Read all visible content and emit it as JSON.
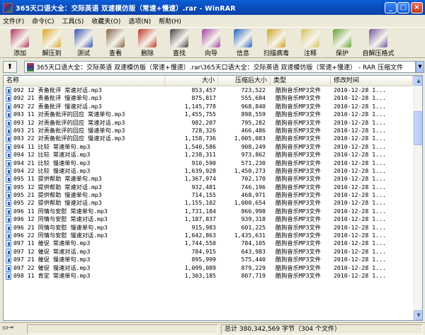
{
  "window": {
    "title": "365天口语大全：交际英语 双速模仿版（常速+慢速）.rar - WinRAR",
    "minimize": "_",
    "maximize": "□",
    "close": "×"
  },
  "menu": [
    "文件(F)",
    "命令(C)",
    "工具(S)",
    "收藏夹(O)",
    "选项(N)",
    "帮助(H)"
  ],
  "toolbar": [
    {
      "label": "添加",
      "icon": "add-books-icon",
      "color": "#b03060"
    },
    {
      "label": "解压到",
      "icon": "extract-folder-icon",
      "color": "#d9a520"
    },
    {
      "label": "测试",
      "icon": "test-check-icon",
      "color": "#3050b0"
    },
    {
      "label": "查看",
      "icon": "view-glasses-icon",
      "color": "#806040"
    },
    {
      "label": "删除",
      "icon": "delete-icon",
      "color": "#c03020"
    },
    {
      "label": "查找",
      "icon": "find-binoculars-icon",
      "color": "#404040"
    },
    {
      "label": "向导",
      "icon": "wizard-icon",
      "color": "#a040a0"
    },
    {
      "label": "信息",
      "icon": "info-icon",
      "color": "#2060c0"
    },
    {
      "label": "扫描病毒",
      "icon": "virus-scan-icon",
      "color": "#d0a020"
    },
    {
      "label": "注释",
      "icon": "comment-icon",
      "color": "#d8c060"
    },
    {
      "label": "保护",
      "icon": "protect-shield-icon",
      "color": "#60a030"
    },
    {
      "label": "自解压格式",
      "icon": "sfx-icon",
      "color": "#7050a0"
    }
  ],
  "address": {
    "path": "365天口语大全：交际英语 双速模仿版（常速+慢速）.rar\\365天口语大全：交际英语 双速模仿版（常速+慢速） - RAR 压缩文件"
  },
  "columns": {
    "name": "名称",
    "size": "大小",
    "packed": "压缩后大小",
    "type": "类型",
    "modified": "修改时间"
  },
  "files": [
    {
      "name": "092 12 责备批评 常速对话.mp3",
      "size": "853,457",
      "packed": "723,522",
      "type": "酷狗音乐MP3文件",
      "modified": "2010-12-28 1..."
    },
    {
      "name": "092 21 责备批评 慢速单句.mp3",
      "size": "875,817",
      "packed": "555,684",
      "type": "酷狗音乐MP3文件",
      "modified": "2010-12-28 1..."
    },
    {
      "name": "092 22 责备批评 慢速对话.mp3",
      "size": "1,145,778",
      "packed": "968,840",
      "type": "酷狗音乐MP3文件",
      "modified": "2010-12-28 1..."
    },
    {
      "name": "093 11 对责备批评的回应 常速单句.mp3",
      "size": "1,455,755",
      "packed": "898,559",
      "type": "酷狗音乐MP3文件",
      "modified": "2010-12-28 1..."
    },
    {
      "name": "093 12 对责备批评的回应 常速对话.mp3",
      "size": "982,207",
      "packed": "795,282",
      "type": "酷狗音乐MP3文件",
      "modified": "2010-12-28 1..."
    },
    {
      "name": "093 21 对责备批评的回应 慢速单句.mp3",
      "size": "728,326",
      "packed": "466,486",
      "type": "酷狗音乐MP3文件",
      "modified": "2010-12-28 1..."
    },
    {
      "name": "093 22 对责备批评的回应 慢速对话.mp3",
      "size": "1,158,736",
      "packed": "1,005,083",
      "type": "酷狗音乐MP3文件",
      "modified": "2010-12-28 1..."
    },
    {
      "name": "094 11 比较 常速单句.mp3",
      "size": "1,540,586",
      "packed": "908,249",
      "type": "酷狗音乐MP3文件",
      "modified": "2010-12-28 1..."
    },
    {
      "name": "094 12 比较 常速对话.mp3",
      "size": "1,238,311",
      "packed": "973,862",
      "type": "酷狗音乐MP3文件",
      "modified": "2010-12-28 1..."
    },
    {
      "name": "094 21 比较 慢速单句.mp3",
      "size": "910,590",
      "packed": "571,230",
      "type": "酷狗音乐MP3文件",
      "modified": "2010-12-28 1..."
    },
    {
      "name": "094 22 比较 慢速对话.mp3",
      "size": "1,639,928",
      "packed": "1,450,273",
      "type": "酷狗音乐MP3文件",
      "modified": "2010-12-28 1..."
    },
    {
      "name": "095 11 提供帮助 常速单句.mp3",
      "size": "1,367,974",
      "packed": "702,170",
      "type": "酷狗音乐MP3文件",
      "modified": "2010-12-28 1..."
    },
    {
      "name": "095 12 提供帮助 常速对话.mp3",
      "size": "932,481",
      "packed": "746,196",
      "type": "酷狗音乐MP3文件",
      "modified": "2010-12-28 1..."
    },
    {
      "name": "095 21 提供帮助 慢速单句.mp3",
      "size": "714,155",
      "packed": "468,971",
      "type": "酷狗音乐MP3文件",
      "modified": "2010-12-28 1..."
    },
    {
      "name": "095 22 提供帮助 慢速对话.mp3",
      "size": "1,155,102",
      "packed": "1,000,654",
      "type": "酷狗音乐MP3文件",
      "modified": "2010-12-28 1..."
    },
    {
      "name": "096 11 同情与安慰 常速单句.mp3",
      "size": "1,731,184",
      "packed": "866,998",
      "type": "酷狗音乐MP3文件",
      "modified": "2010-12-28 1..."
    },
    {
      "name": "096 12 同情与安慰 常速对话.mp3",
      "size": "1,187,837",
      "packed": "939,318",
      "type": "酷狗音乐MP3文件",
      "modified": "2010-12-28 1..."
    },
    {
      "name": "096 21 同情与安慰 慢速单句.mp3",
      "size": "915,983",
      "packed": "601,225",
      "type": "酷狗音乐MP3文件",
      "modified": "2010-12-28 1..."
    },
    {
      "name": "096 22 同情与安慰 慢速对话.mp3",
      "size": "1,642,863",
      "packed": "1,435,631",
      "type": "酷狗音乐MP3文件",
      "modified": "2010-12-28 1..."
    },
    {
      "name": "097 11 催促 常速单句.mp3",
      "size": "1,744,550",
      "packed": "784,105",
      "type": "酷狗音乐MP3文件",
      "modified": "2010-12-28 1..."
    },
    {
      "name": "097 12 催促 常速对话.mp3",
      "size": "784,915",
      "packed": "643,983",
      "type": "酷狗音乐MP3文件",
      "modified": "2010-12-28 1..."
    },
    {
      "name": "097 21 催促 慢速单句.mp3",
      "size": "895,999",
      "packed": "575,440",
      "type": "酷狗音乐MP3文件",
      "modified": "2010-12-28 1..."
    },
    {
      "name": "097 22 催促 慢速对话.mp3",
      "size": "1,099,089",
      "packed": "879,229",
      "type": "酷狗音乐MP3文件",
      "modified": "2010-12-28 1..."
    },
    {
      "name": "098 11 肯定 常速单句.mp3",
      "size": "1,303,185",
      "packed": "807,719",
      "type": "酷狗音乐MP3文件",
      "modified": "2010-12-28 1..."
    }
  ],
  "status": {
    "total": "总计 380,342,569 字节（304 个文件）"
  }
}
